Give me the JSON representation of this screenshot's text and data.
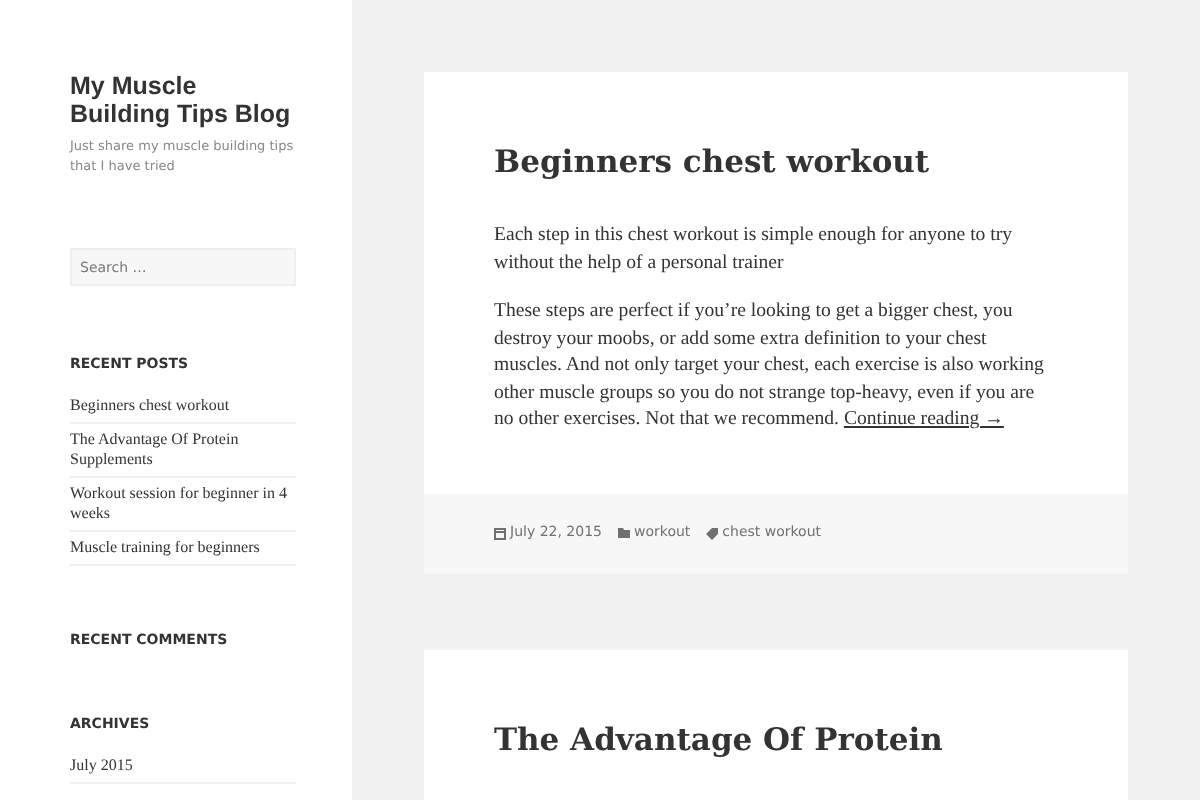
{
  "site": {
    "title": "My Muscle Building Tips Blog",
    "description": "Just share my muscle building tips that I have tried"
  },
  "search": {
    "placeholder": "Search …"
  },
  "widgets": [
    {
      "title": "RECENT POSTS",
      "items": [
        "Beginners chest workout",
        "The Advantage Of Protein Supplements",
        "Workout session for beginner in 4 weeks",
        "Muscle training for beginners"
      ]
    },
    {
      "title": "RECENT COMMENTS"
    },
    {
      "title": "ARCHIVES",
      "items": [
        "July 2015"
      ]
    }
  ],
  "posts": [
    {
      "title": "Beginners chest workout",
      "paragraphs": [
        "Each step in this chest workout is simple enough for anyone to try without the help of a personal trainer",
        "These steps are perfect if you’re looking to get a bigger chest, you destroy your moobs, or add some extra definition to your chest muscles. And not only target your chest, each exercise is also working other muscle groups so you do not strange top-heavy, even if you are no other exercises. Not that we recommend."
      ],
      "more_link": "Continue reading →",
      "meta": {
        "date": "July 22, 2015",
        "category": "workout",
        "tag": "chest workout"
      }
    },
    {
      "title": "The Advantage Of Protein"
    }
  ]
}
